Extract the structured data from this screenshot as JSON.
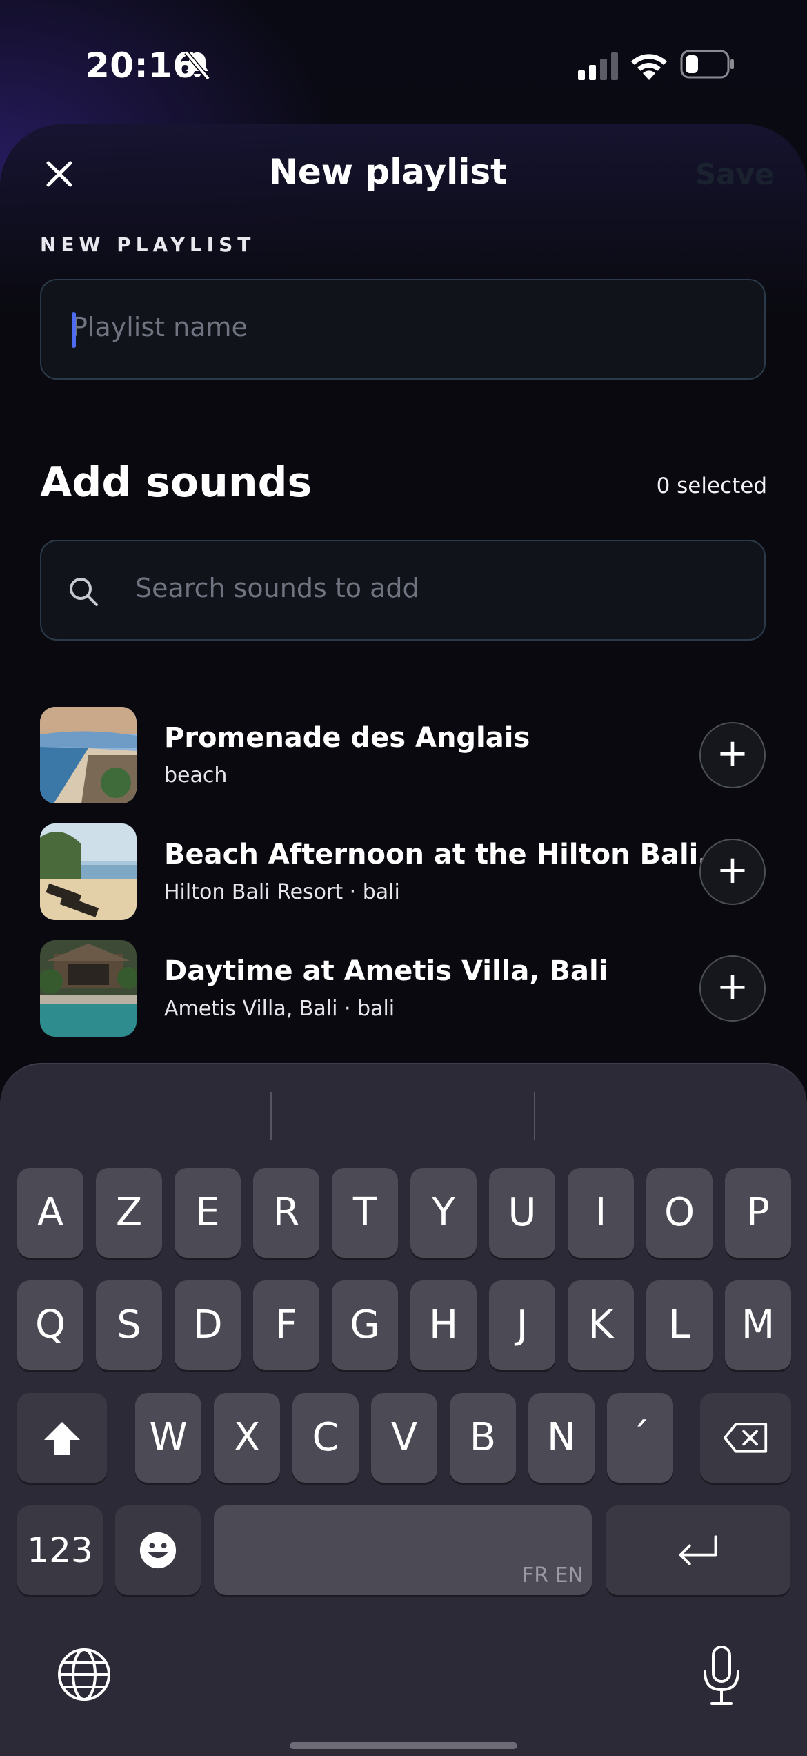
{
  "status_bar": {
    "time": "20:16"
  },
  "header": {
    "title": "New playlist",
    "save_label": "Save"
  },
  "playlist": {
    "section_label": "NEW PLAYLIST",
    "name_placeholder": "Playlist name"
  },
  "add_sounds": {
    "title": "Add sounds",
    "selected_count": "0 selected",
    "search_placeholder": "Search sounds to add"
  },
  "sounds": [
    {
      "title": "Promenade des Anglais",
      "subtitle": "beach"
    },
    {
      "title": "Beach Afternoon at the Hilton Bali…",
      "subtitle": "Hilton Bali Resort · bali"
    },
    {
      "title": "Daytime at Ametis Villa, Bali",
      "subtitle": "Ametis Villa, Bali · bali"
    }
  ],
  "keyboard": {
    "row1": [
      "A",
      "Z",
      "E",
      "R",
      "T",
      "Y",
      "U",
      "I",
      "O",
      "P"
    ],
    "row2": [
      "Q",
      "S",
      "D",
      "F",
      "G",
      "H",
      "J",
      "K",
      "L",
      "M"
    ],
    "row3": [
      "W",
      "X",
      "C",
      "V",
      "B",
      "N",
      "´"
    ],
    "numbers_label": "123",
    "space_lang": "FR EN"
  },
  "colors": {
    "accent": "#4f6cf0",
    "background": "#09090f",
    "field_border": "#2a3a48"
  }
}
